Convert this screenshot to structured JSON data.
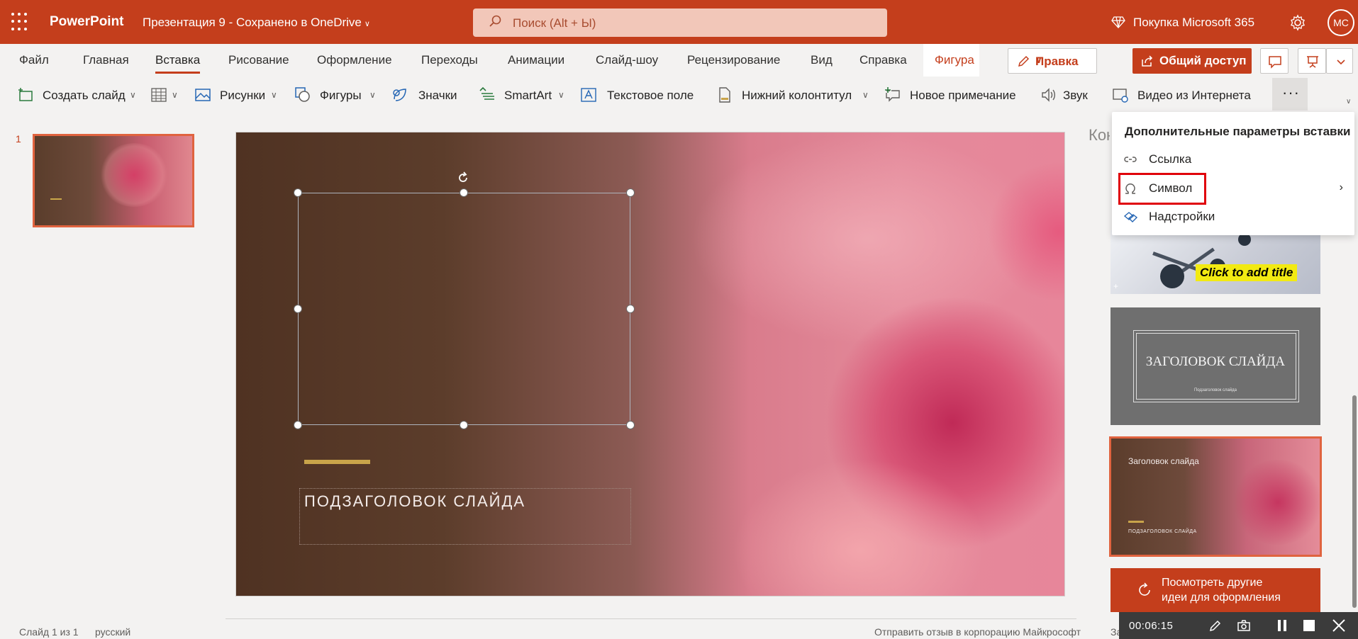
{
  "titlebar": {
    "app_name": "PowerPoint",
    "doc_title": "Презентация 9 - Сохранено в OneDrive",
    "search_placeholder": "Поиск (Alt + Ы)",
    "buy_label": "Покупка Microsoft 365",
    "avatar_initials": "МС"
  },
  "tabs": [
    {
      "label": "Файл"
    },
    {
      "label": "Главная"
    },
    {
      "label": "Вставка",
      "active": true
    },
    {
      "label": "Рисование"
    },
    {
      "label": "Оформление"
    },
    {
      "label": "Переходы"
    },
    {
      "label": "Анимации"
    },
    {
      "label": "Слайд-шоу"
    },
    {
      "label": "Рецензирование"
    },
    {
      "label": "Вид"
    },
    {
      "label": "Справка"
    },
    {
      "label": "Фигура"
    }
  ],
  "actions": {
    "edit_label": "Правка",
    "share_label": "Общий доступ"
  },
  "ribbon": {
    "new_slide": "Создать слайд",
    "pictures": "Рисунки",
    "shapes": "Фигуры",
    "icons": "Значки",
    "smartart": "SmartArt",
    "textbox": "Текстовое поле",
    "footer": "Нижний колонтитул",
    "new_comment": "Новое примечание",
    "audio": "Звук",
    "online_video": "Видео из Интернета",
    "more": "···"
  },
  "slides_panel": {
    "slide_number": "1"
  },
  "slide": {
    "subtitle": "ПОДЗАГОЛОВОК СЛАЙДА"
  },
  "designer": {
    "title_partial": "Кон",
    "idea1_title": "Click to add title",
    "idea2_title": "ЗАГОЛОВОК СЛАЙДА",
    "idea2_subtitle": "Подзаголовок слайда",
    "idea3_title": "Заголовок слайда",
    "idea3_subtitle": "ПОДЗАГОЛОВОК СЛАЙДА",
    "more_ideas_line1": "Посмотреть другие",
    "more_ideas_line2": "идеи для оформления"
  },
  "dropdown": {
    "header": "Дополнительные параметры вставки",
    "items": [
      {
        "label": "Ссылка",
        "icon": "link-icon"
      },
      {
        "label": "Символ",
        "icon": "omega-icon",
        "has_submenu": true
      },
      {
        "label": "Надстройки",
        "icon": "addins-icon"
      }
    ]
  },
  "statusbar": {
    "slide_info": "Слайд 1 из 1",
    "language": "русский",
    "feedback": "Отправить отзыв в корпорацию Майкрософт",
    "notes": "Заметки"
  },
  "recorder": {
    "time": "00:06:15"
  },
  "colors": {
    "accent": "#c43e1c",
    "highlight": "#e0000a"
  }
}
